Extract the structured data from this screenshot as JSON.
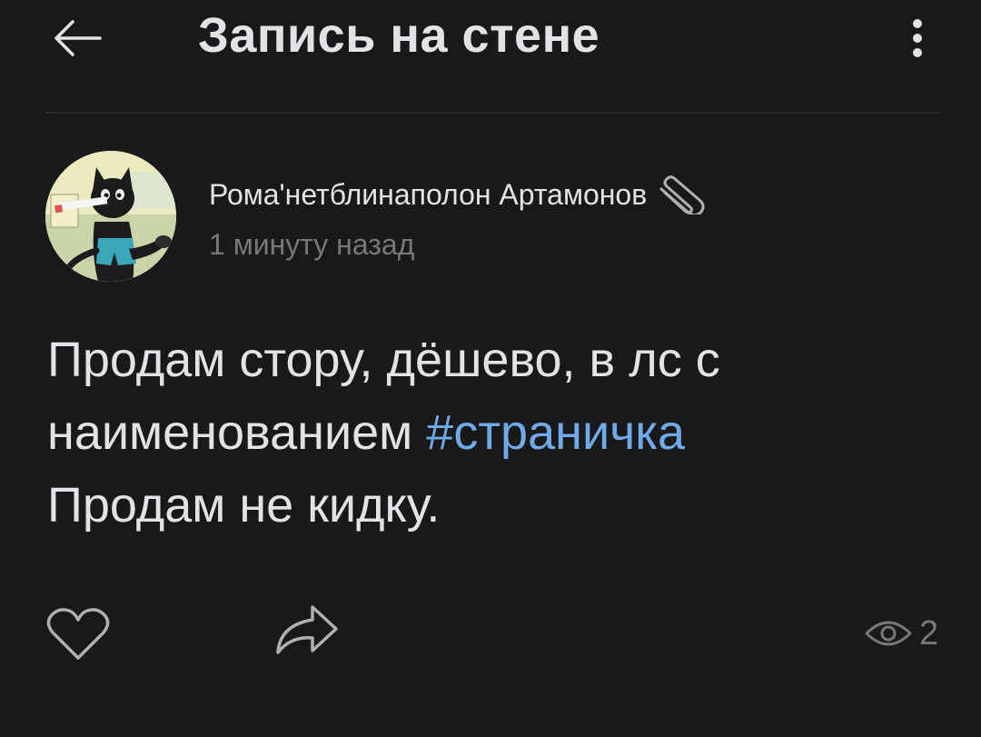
{
  "header": {
    "title": "Запись на стене",
    "back_icon": "arrow-left-icon",
    "more_icon": "more-vertical-icon"
  },
  "post": {
    "author": "Рома'нетблинаполон Артамонов",
    "author_badge_icon": "paperclip-icon",
    "time": "1 минуту назад",
    "text_line1": "Продам стору, дёшево, в лс с",
    "text_line2_prefix": "наименованием ",
    "hashtag": "#страничка",
    "text_line3": "Продам не кидку."
  },
  "actions": {
    "like_icon": "heart-icon",
    "share_icon": "share-arrow-icon",
    "views_icon": "eye-icon",
    "views_count": "2"
  },
  "colors": {
    "background": "#19191a",
    "text": "#e1e3e6",
    "secondary": "#76787a",
    "link": "#71aaeb",
    "divider": "#2c2d2e"
  }
}
